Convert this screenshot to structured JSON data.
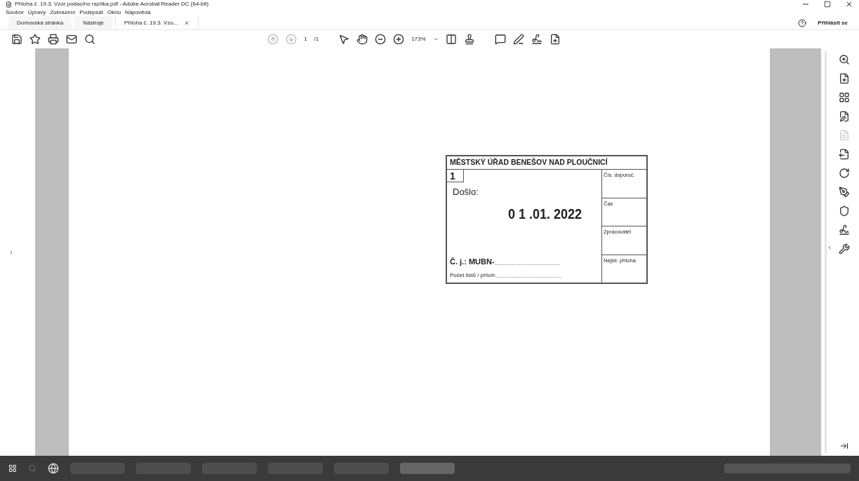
{
  "window": {
    "title": "Příloha č. 19.3. Vzor podacího razítka.pdf - Adobe Acrobat Reader DC (64-bit)"
  },
  "menu": [
    "Soubor",
    "Úpravy",
    "Zobrazení",
    "Podepsat",
    "Okno",
    "Nápověda"
  ],
  "tabs": [
    {
      "label": "Domovská stránka",
      "selected": false,
      "closable": false
    },
    {
      "label": "Nástroje",
      "selected": false,
      "closable": false
    },
    {
      "label": "Příloha č. 19.3. Vzo...",
      "selected": true,
      "closable": true
    }
  ],
  "help": {
    "label": "Přihlásit se"
  },
  "toolbar": {
    "page": "1",
    "page_total": "/1",
    "zoom": "173%"
  },
  "stamp": {
    "title": "MĚSTSKÝ ÚŘAD BENEŠOV NAD PLOUČNICÍ",
    "number": "1",
    "received_label": "Došlo:",
    "date": "0 1 .01. 2022",
    "ref_label": "Č. j.: MUBN-",
    "ref_dots": "................................................",
    "count_label": "Počet listů / příloh:",
    "count_dots": "................................................",
    "side_fields": [
      "Čís. doporuč.",
      "Čas",
      "Zpracovatel",
      "Nejist. příloha"
    ]
  }
}
